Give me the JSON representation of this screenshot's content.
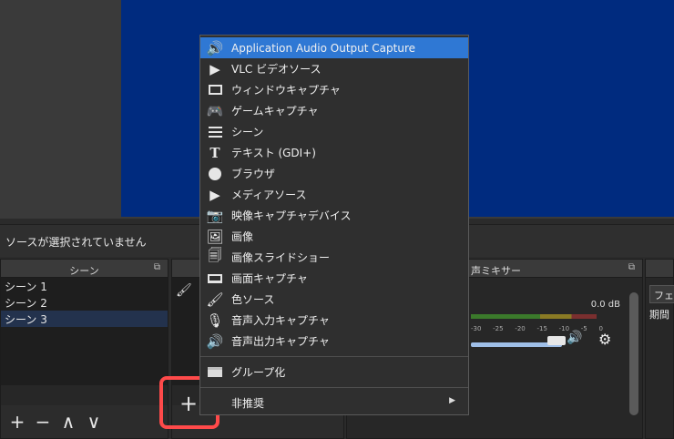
{
  "status_text": "ソースが選択されていません",
  "scenes": {
    "title": "シーン",
    "items": [
      "シーン 1",
      "シーン 2",
      "シーン 3"
    ],
    "toolbar": [
      "+",
      "−",
      "∧",
      "∨"
    ]
  },
  "sources": {
    "add_label": "+"
  },
  "mixer": {
    "title": "音声ミキサー",
    "title_visible": "声ミキサー",
    "db_value": "0.0 dB",
    "meter_ticks": [
      "-30",
      "-25",
      "-20",
      "-15",
      "-10",
      "-5",
      "0"
    ],
    "colors": {
      "green": "#3b7a2b",
      "yellow": "#8a7a24",
      "red": "#7a2f2f",
      "slider": "#9fbfe8"
    }
  },
  "transitions": {
    "select_value": "フェ",
    "duration_label": "期間"
  },
  "context_menu": {
    "items": [
      {
        "label": "Application Audio Output Capture",
        "icon": "speaker-icon",
        "active": true
      },
      {
        "label": "VLC ビデオソース",
        "icon": "play-icon"
      },
      {
        "label": "ウィンドウキャプチャ",
        "icon": "window-icon"
      },
      {
        "label": "ゲームキャプチャ",
        "icon": "gamepad-icon"
      },
      {
        "label": "シーン",
        "icon": "list-icon"
      },
      {
        "label": "テキスト (GDI+)",
        "icon": "text-icon"
      },
      {
        "label": "ブラウザ",
        "icon": "globe-icon"
      },
      {
        "label": "メディアソース",
        "icon": "play-icon"
      },
      {
        "label": "映像キャプチャデバイス",
        "icon": "camera-icon"
      },
      {
        "label": "画像",
        "icon": "image-icon"
      },
      {
        "label": "画像スライドショー",
        "icon": "slideshow-icon"
      },
      {
        "label": "画面キャプチャ",
        "icon": "monitor-icon"
      },
      {
        "label": "色ソース",
        "icon": "brush-icon"
      },
      {
        "label": "音声入力キャプチャ",
        "icon": "microphone-icon"
      },
      {
        "label": "音声出力キャプチャ",
        "icon": "speaker-icon"
      }
    ],
    "group_label": "グループ化",
    "deprecated_label": "非推奨"
  },
  "colors": {
    "preview_bg": "#002b7f",
    "highlight_border": "#ff4a4a",
    "menu_active": "#2f78d4"
  }
}
